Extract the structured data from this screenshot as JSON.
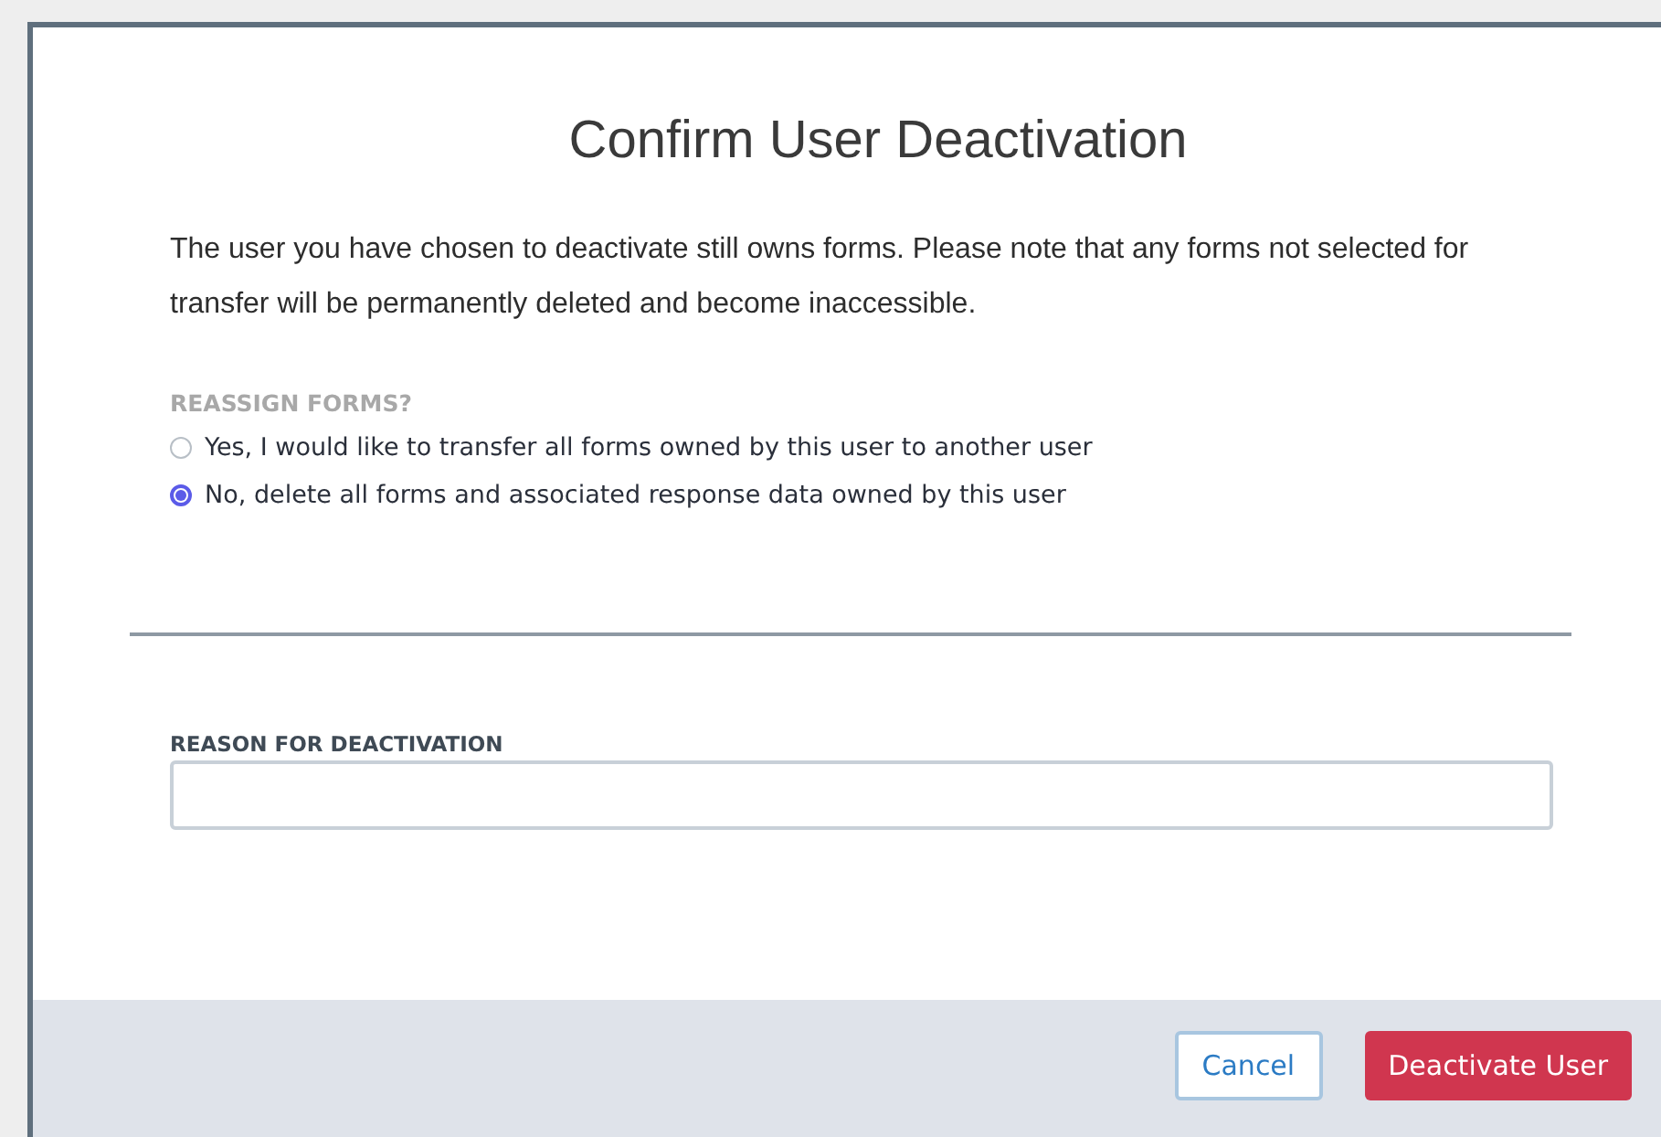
{
  "dialog": {
    "title": "Confirm User Deactivation",
    "message": "The user you have chosen to deactivate still owns forms. Please note that any forms not selected for transfer will be permanently deleted and become inaccessible."
  },
  "reassign": {
    "label": "REASSIGN FORMS?",
    "options": [
      {
        "label": "Yes, I would like to transfer all forms owned by this user to another user",
        "selected": false
      },
      {
        "label": "No, delete all forms and associated response data owned by this user",
        "selected": true
      }
    ]
  },
  "reason": {
    "label": "REASON FOR DEACTIVATION"
  },
  "buttons": [
    {
      "label": "Cancel",
      "kind": "secondary"
    },
    {
      "label": "Deactivate User",
      "kind": "danger"
    }
  ]
}
